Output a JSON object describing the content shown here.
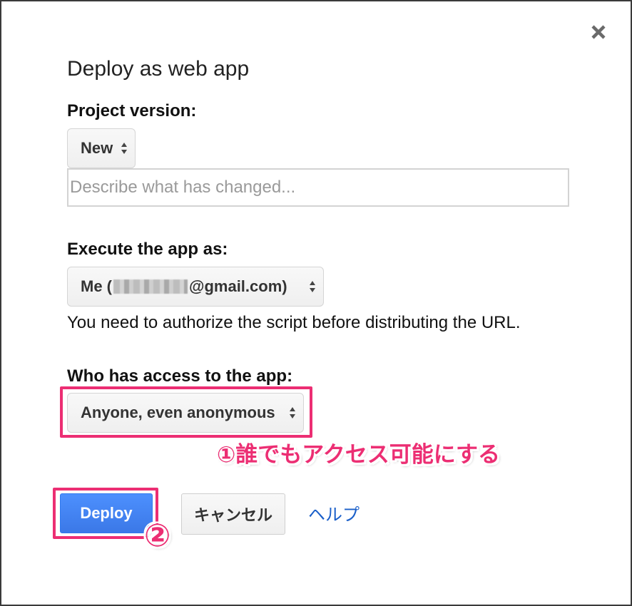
{
  "dialog": {
    "title": "Deploy as web app",
    "close_icon": "close-icon"
  },
  "project_version": {
    "label": "Project version:",
    "selected": "New",
    "description_placeholder": "Describe what has changed...",
    "description_value": ""
  },
  "execute_as": {
    "label": "Execute the app as:",
    "selected_prefix": "Me (",
    "selected_suffix": "@gmail.com)",
    "note": "You need to authorize the script before distributing the URL."
  },
  "access": {
    "label": "Who has access to the app:",
    "selected": "Anyone, even anonymous"
  },
  "annotations": {
    "step1": "①誰でもアクセス可能にする",
    "step2": "②",
    "highlight_color": "#ec2e73"
  },
  "buttons": {
    "deploy": "Deploy",
    "cancel": "キャンセル",
    "help": "ヘルプ"
  },
  "colors": {
    "primary_button": "#4d90fe",
    "link": "#1a5fc9"
  }
}
